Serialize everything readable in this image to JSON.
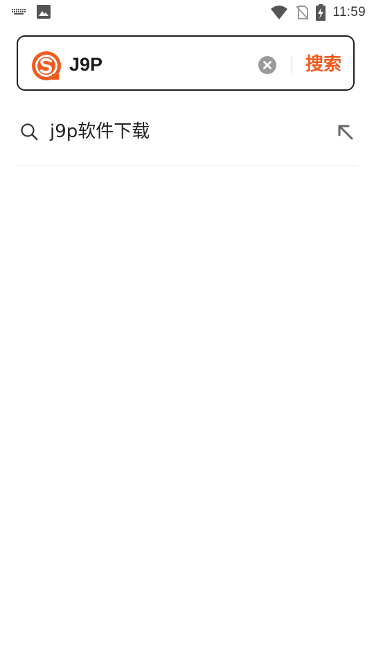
{
  "status_bar": {
    "time": "11:59",
    "icons": [
      "keyboard-icon",
      "image-icon",
      "wifi-icon",
      "no-sim-icon",
      "battery-charging-icon"
    ]
  },
  "search": {
    "logo": "sogou-logo",
    "query": "J9P",
    "clear_icon": "clear-icon",
    "button_label": "搜索"
  },
  "suggestions": [
    {
      "text": "j9p软件下载",
      "icon": "search-icon",
      "action_icon": "arrow-up-left-icon"
    }
  ],
  "colors": {
    "accent": "#f15a1e",
    "border": "#1f1f1f",
    "text": "#222222",
    "icon_gray": "#9a9a9a"
  }
}
